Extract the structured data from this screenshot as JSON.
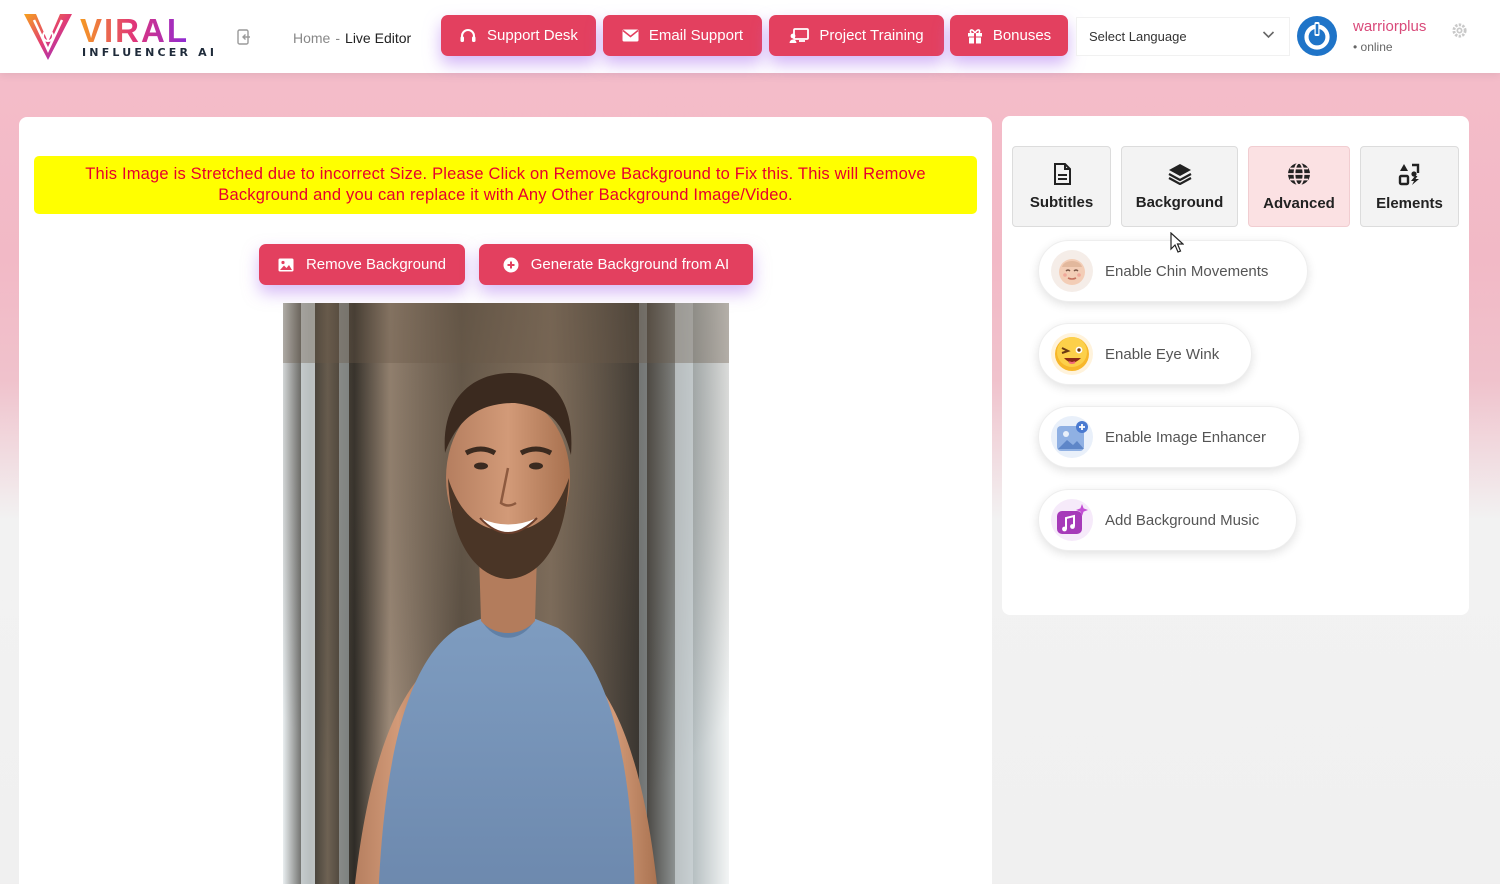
{
  "header": {
    "logo_text": "VIRAL",
    "logo_sub": "INFLUENCER AI",
    "breadcrumb": {
      "home": "Home",
      "separator": "-",
      "current": "Live Editor"
    },
    "buttons": [
      {
        "label": "Support Desk",
        "icon": "headset-icon"
      },
      {
        "label": "Email Support",
        "icon": "envelope-icon"
      },
      {
        "label": "Project Training",
        "icon": "chalkboard-icon"
      },
      {
        "label": "Bonuses",
        "icon": "gift-icon"
      }
    ],
    "language_select": {
      "value": "Select Language"
    },
    "user": {
      "name": "warriorplus",
      "status": "• online"
    }
  },
  "editor": {
    "warning": "This Image is Stretched due to incorrect Size. Please Click on Remove Background to Fix this. This will Remove Background and you can replace it with Any Other Background Image/Video.",
    "remove_bg_label": "Remove Background",
    "generate_bg_label": "Generate Background from AI"
  },
  "sidebar": {
    "tabs": [
      {
        "label": "Subtitles",
        "icon": "file-icon",
        "active": false
      },
      {
        "label": "Background",
        "icon": "layers-icon",
        "active": false
      },
      {
        "label": "Advanced",
        "icon": "globe-icon",
        "active": true
      },
      {
        "label": "Elements",
        "icon": "shapes-icon",
        "active": false
      }
    ],
    "features": [
      {
        "label": "Enable Chin Movements",
        "icon": "face-icon"
      },
      {
        "label": "Enable Eye Wink",
        "icon": "wink-emoji-icon"
      },
      {
        "label": "Enable Image Enhancer",
        "icon": "image-enhance-icon"
      },
      {
        "label": "Add Background Music",
        "icon": "music-icon"
      }
    ]
  },
  "colors": {
    "accent": "#e3405f",
    "active_tab": "#fbe1e3",
    "warning_bg": "#ffff00",
    "warning_text": "#e6002e",
    "avatar": "#1f74c8"
  }
}
